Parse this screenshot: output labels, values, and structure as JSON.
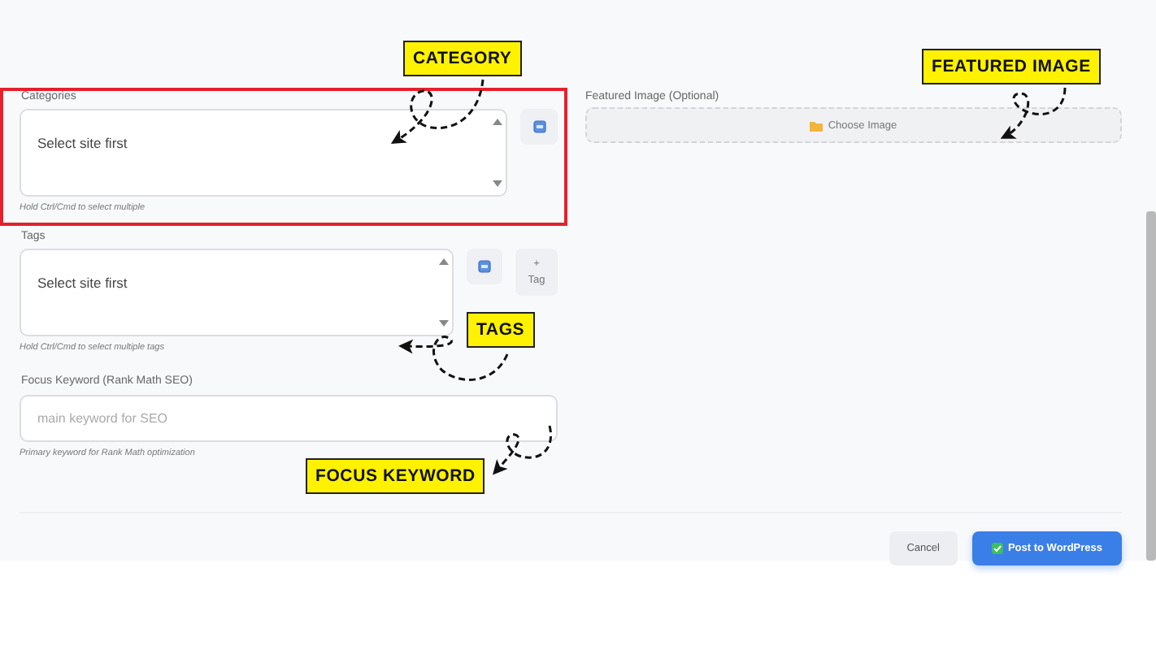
{
  "categories": {
    "label": "Categories",
    "value": "Select site first",
    "hint": "Hold Ctrl/Cmd to select multiple"
  },
  "tags": {
    "label": "Tags",
    "value": "Select site first",
    "add_button": {
      "symbol": "+",
      "label": "Tag"
    },
    "hint": "Hold Ctrl/Cmd to select multiple tags"
  },
  "focus_keyword": {
    "label": "Focus Keyword (Rank Math SEO)",
    "placeholder": "main keyword for SEO",
    "hint": "Primary keyword for Rank Math optimization"
  },
  "featured_image": {
    "label": "Featured Image (Optional)",
    "button": "Choose Image"
  },
  "buttons": [
    {
      "label": "Cancel",
      "kind": "secondary"
    },
    {
      "label": "Post to WordPress",
      "kind": "primary"
    }
  ],
  "annotations": [
    {
      "label": "CATEGORY"
    },
    {
      "label": "FEATURED IMAGE"
    },
    {
      "label": "TAGS"
    },
    {
      "label": "FOCUS KEYWORD"
    }
  ]
}
